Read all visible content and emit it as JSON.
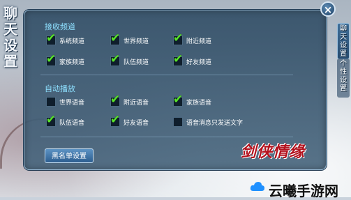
{
  "title_left": "聊天设置",
  "close_symbol": "×",
  "receive_section": {
    "title": "接收频道",
    "options": [
      {
        "label": "系统频道",
        "checked": true
      },
      {
        "label": "世界频道",
        "checked": true
      },
      {
        "label": "附近频道",
        "checked": true
      },
      {
        "label": "家族频道",
        "checked": true
      },
      {
        "label": "队伍频道",
        "checked": true
      },
      {
        "label": "好友频道",
        "checked": true
      }
    ]
  },
  "autoplay_section": {
    "title": "自动播放",
    "options": [
      {
        "label": "世界语音",
        "checked": false
      },
      {
        "label": "附近语音",
        "checked": true
      },
      {
        "label": "家族语音",
        "checked": true
      },
      {
        "label": "队伍语音",
        "checked": true
      },
      {
        "label": "好友语音",
        "checked": true
      },
      {
        "label": "语音消息只发送文字",
        "checked": false
      }
    ]
  },
  "blacklist_button": "黑名单设置",
  "tabs": {
    "chat": "聊天设置",
    "personal": "个性设置"
  },
  "game_logo": "剑侠情缘",
  "watermark": "云曦手游网",
  "check_glyph": "✔",
  "colors": {
    "check": "#59e32a",
    "section_title": "#8ee0ff",
    "logo_red": "#b3121e"
  }
}
